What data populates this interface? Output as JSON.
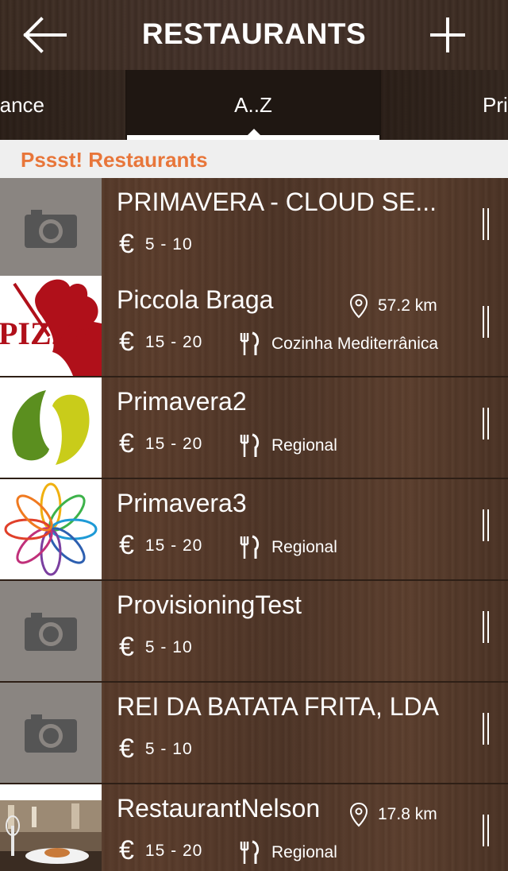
{
  "header": {
    "title": "RESTAURANTS",
    "back_icon": "arrow-left-icon",
    "add_icon": "plus-icon"
  },
  "tabs": [
    {
      "label": "ance",
      "selected": false
    },
    {
      "label": "A..Z",
      "selected": true
    },
    {
      "label": "Pri",
      "selected": false
    }
  ],
  "section": {
    "title": "Pssst! Restaurants",
    "color": "#e8763a"
  },
  "restaurants": [
    {
      "name": "PRIMAVERA - CLOUD SE...",
      "distance": "",
      "currency": "€",
      "price": "5 - 10",
      "cuisine": "",
      "thumb": "camera-placeholder"
    },
    {
      "name": "Piccola Braga",
      "distance": "57.2 km",
      "currency": "€",
      "price": "15 - 20",
      "cuisine": "Cozinha Mediterrânica",
      "thumb": "pizza-logo",
      "logo_text": "PIZZA"
    },
    {
      "name": "Primavera2",
      "distance": "",
      "currency": "€",
      "price": "15 - 20",
      "cuisine": "Regional",
      "thumb": "leaf-logo"
    },
    {
      "name": "Primavera3",
      "distance": "",
      "currency": "€",
      "price": "15 - 20",
      "cuisine": "Regional",
      "thumb": "flower-logo"
    },
    {
      "name": "ProvisioningTest",
      "distance": "",
      "currency": "€",
      "price": "5 - 10",
      "cuisine": "",
      "thumb": "camera-placeholder"
    },
    {
      "name": "REI DA BATATA FRITA, LDA",
      "distance": "",
      "currency": "€",
      "price": "5 - 10",
      "cuisine": "",
      "thumb": "camera-placeholder"
    },
    {
      "name": "RestaurantNelson",
      "distance": "17.8 km",
      "currency": "€",
      "price": "15 - 20",
      "cuisine": "Regional",
      "thumb": "restaurant-photo"
    }
  ]
}
